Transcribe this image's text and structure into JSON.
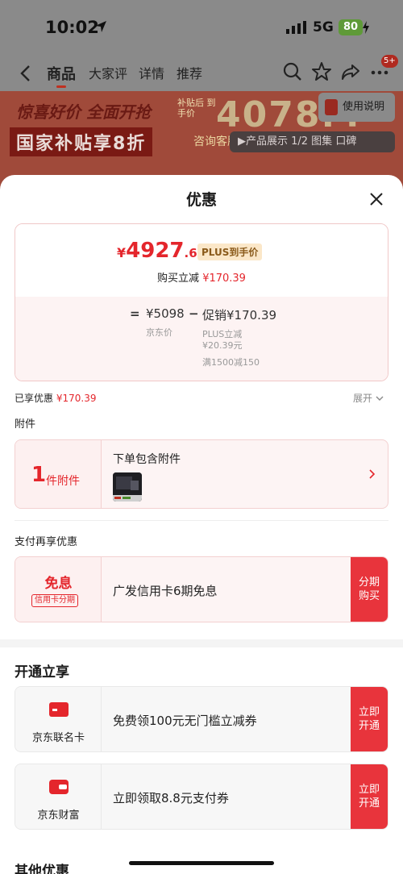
{
  "status_bar": {
    "time": "10:02",
    "network": "5G",
    "battery": "80"
  },
  "nav": {
    "tabs": [
      "商品",
      "大家评",
      "详情",
      "推荐"
    ],
    "active_tab": "商品",
    "message_badge": "5+"
  },
  "background_promo": {
    "headline": "惊喜好价 全面开抢",
    "subsidy": "国家补贴享8折",
    "price_hint": "补贴后 到手价",
    "big_number": "4078.4",
    "consult": "咨询客服",
    "manual": "使用说明",
    "gallery": "▶产品展示 1/2 图集 口碑"
  },
  "sheet": {
    "title": "优惠",
    "price": {
      "symbol": "¥",
      "integer": "4927",
      "decimal": ".61",
      "plus_tag": "PLUS到手价"
    },
    "instant_reduce": {
      "label": "购买立减",
      "amount": "¥170.39"
    },
    "formula": {
      "equals": "=",
      "jd_price": "¥5098",
      "jd_price_label": "京东价",
      "minus": "−",
      "promo": "促销¥170.39",
      "promo_details": [
        "PLUS立减",
        "¥20.39元",
        "满1500减150"
      ]
    },
    "enjoyed": {
      "label": "已享优惠",
      "amount": "¥170.39",
      "expand": "展开"
    },
    "accessories": {
      "section": "附件",
      "count": "1",
      "count_label": "件附件",
      "title": "下单包含附件"
    },
    "payment": {
      "section": "支付再享优惠",
      "tag": "免息",
      "tag_sub": "信用卡分期",
      "desc": "广发信用卡6期免息",
      "button": "分期购买"
    },
    "open_enjoy": {
      "section": "开通立享",
      "items": [
        {
          "name": "京东联名卡",
          "desc": "免费领100元无门槛立减券",
          "button": "立即开通"
        },
        {
          "name": "京东财富",
          "desc": "立即领取8.8元支付券",
          "button": "立即开通"
        }
      ]
    },
    "other": {
      "section": "其他优惠"
    }
  },
  "colors": {
    "accent": "#e4262c",
    "button": "#e8343c",
    "plus_tag_bg": "#fbe7c8"
  }
}
